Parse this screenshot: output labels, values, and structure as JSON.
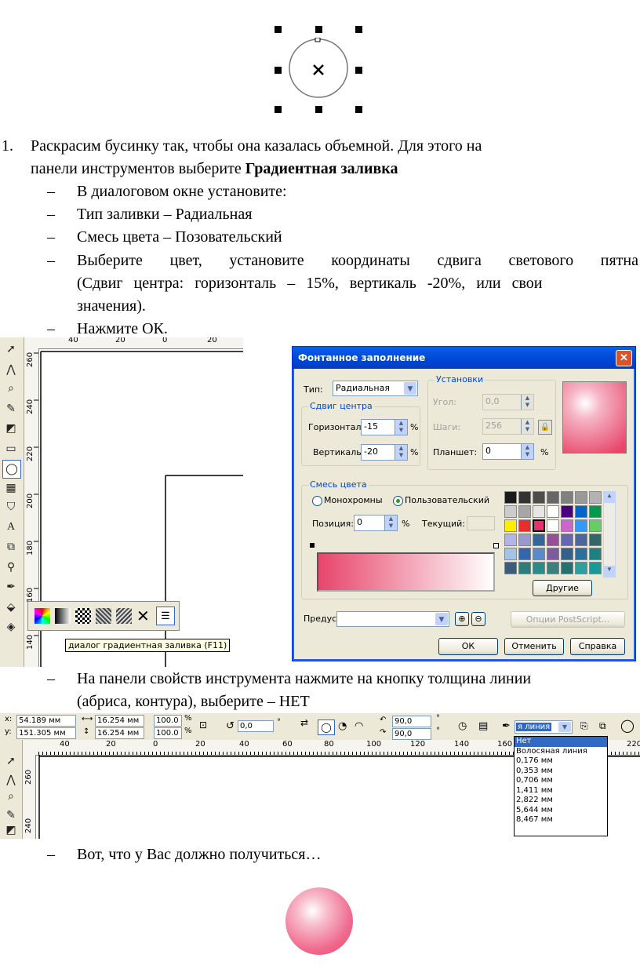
{
  "steps": {
    "step1": {
      "number": "1.",
      "line1": "Раскрасим бусинку так, чтобы она казалась объемной. Для этого на",
      "line2_prefix": "панели инструментов выберите ",
      "line2_bold": "Градиентная заливка"
    },
    "bullets": [
      "В диалоговом окне установите:",
      "Тип заливки – Радиальная",
      "Смесь цвета – Позовательский",
      "Выберите цвет, установите координаты сдвига светового пятна",
      "(Сдвиг центра: горизонталь – 15%, вертикаль -20%, или свои",
      "значения).",
      "Нажмите ОК."
    ],
    "bullet2": [
      "На панели свойств инструмента нажмите на кнопку толщина линии",
      "(абриса, контура), выберите – НЕТ"
    ],
    "bullet3": "Вот, что у Вас должно получиться…",
    "dash": "–"
  },
  "corel1": {
    "vruler_labels": [
      "260",
      "240",
      "220",
      "200",
      "180",
      "160",
      "140"
    ],
    "hruler_labels": [
      "40",
      "20",
      "0",
      "20"
    ],
    "tooltip": "диалог градиентная заливка (F11)"
  },
  "dialog": {
    "title": "Фонтанное заполнение",
    "close": "✕",
    "type_label": "Тип:",
    "type_value": "Радиальная",
    "center_offset_title": "Сдвиг центра",
    "horizontal_label": "Горизонталь",
    "horizontal_value": "-15",
    "vertical_label": "Вертикаль",
    "vertical_value": "-20",
    "percent": "%",
    "settings_title": "Установки",
    "angle_label": "Угол:",
    "angle_value": "0,0",
    "steps_label": "Шаги:",
    "steps_value": "256",
    "edge_pad_label": "Планшет:",
    "edge_pad_value": "0",
    "color_blend_title": "Смесь цвета",
    "two_color_label": "Монохромны",
    "custom_label": "Пользовательский",
    "position_label": "Позиция:",
    "position_value": "0",
    "current_label": "Текущий:",
    "others_button": "Другие",
    "presets_label": "Предуст",
    "postscript_button": "Опции PostScript...",
    "ok_button": "ОК",
    "cancel_button": "Отменить",
    "help_button": "Справка",
    "palette_colors": [
      "#1a1a1a",
      "#333333",
      "#4d4d4d",
      "#666666",
      "#808080",
      "#999999",
      "#b3b3b3",
      "#cccccc",
      "#a6a6a6",
      "#e6e6e6",
      "#ffffff",
      "#4b0082",
      "#0066cc",
      "#00994d",
      "#ffee00",
      "#e62e2e",
      "#e6336b",
      "#ffffff",
      "#cc66cc",
      "#3399ff",
      "#66cc66",
      "#b3b3e6",
      "#9999cc",
      "#336699",
      "#994d99",
      "#6666b3",
      "#4d6699",
      "#336666",
      "#a6c3e6",
      "#3366aa",
      "#5a8ac8",
      "#7e5a9e",
      "#34608c",
      "#2a6f9e",
      "#1f8080",
      "#3c5c7c",
      "#2e7d7d",
      "#2b8a8a",
      "#3a8080",
      "#277070",
      "#2e9e9e",
      "#1a9999"
    ]
  },
  "propbar": {
    "x_label": "x:",
    "x_value": "54.189 мм",
    "y_label": "y:",
    "y_value": "151.305 мм",
    "w_value": "16.254 мм",
    "h_value": "16.254 мм",
    "scale_x": "100.0",
    "scale_y": "100.0",
    "percent": "%",
    "rotation_value": "0,0",
    "angle1": "90,0",
    "angle2": "90,0",
    "degree": "°",
    "outline_value": "я линия",
    "hruler_labels": [
      "40",
      "20",
      "0",
      "20",
      "40",
      "60",
      "80",
      "100",
      "120",
      "140",
      "160",
      "220"
    ],
    "vruler_labels": [
      "260",
      "240"
    ],
    "dropdown_items": [
      "Нет",
      "Волосяная линия",
      "0,176 мм",
      "0,353 мм",
      "0,706 мм",
      "1,411 мм",
      "2,822 мм",
      "5,644 мм",
      "8,467 мм"
    ]
  },
  "colors": {
    "gradient_pink": "#e8456a",
    "selection_blue": "#316ac5",
    "dialog_bg": "#ece9d8",
    "title_blue": "#0046d5"
  }
}
